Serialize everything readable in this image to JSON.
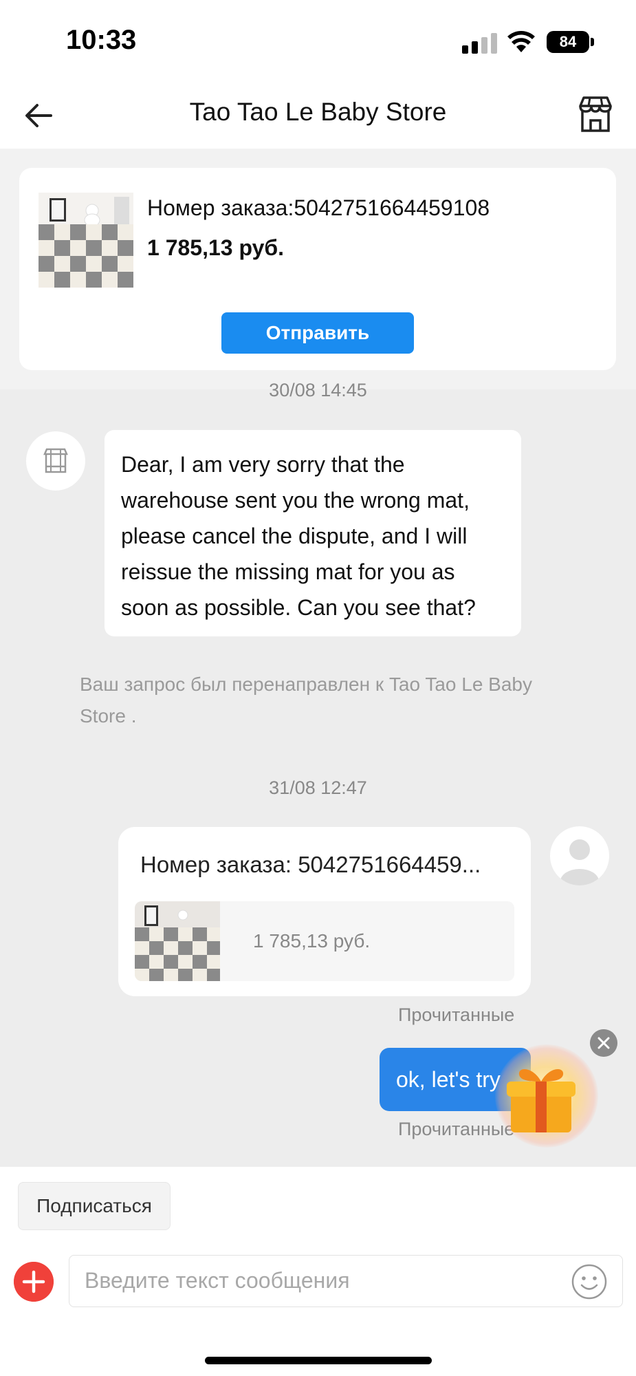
{
  "status_bar": {
    "time": "10:33",
    "battery": "84"
  },
  "header": {
    "title": "Tao Tao Le Baby Store",
    "back_icon": "arrow-left-icon",
    "store_icon": "storefront-icon"
  },
  "order_card": {
    "order_number": "Номер заказа:5042751664459108",
    "price": "1 785,13 руб.",
    "send_label": "Отправить"
  },
  "chat": {
    "timestamp_1": "30/08 14:45",
    "incoming_message": "Dear, I am very sorry that the warehouse sent you the wrong mat, please cancel the dispute, and I will reissue the missing mat for you as soon as possible. Can you see that?",
    "system_note": "Ваш запрос был перенаправлен к Tao Tao Le Baby Store .",
    "timestamp_2": "31/08 12:47",
    "order_bubble": {
      "title": "Номер заказа: 5042751664459...",
      "price": "1 785,13 руб."
    },
    "read_status_1": "Прочитанные",
    "outgoing_message": "ok, let's try",
    "read_status_2": "Прочитанные"
  },
  "footer": {
    "subscribe_label": "Подписаться",
    "input_placeholder": "Введите текст сообщения"
  },
  "colors": {
    "accent_blue": "#1a8cf0",
    "bubble_blue": "#2a85e8",
    "add_red": "#f0413a"
  }
}
